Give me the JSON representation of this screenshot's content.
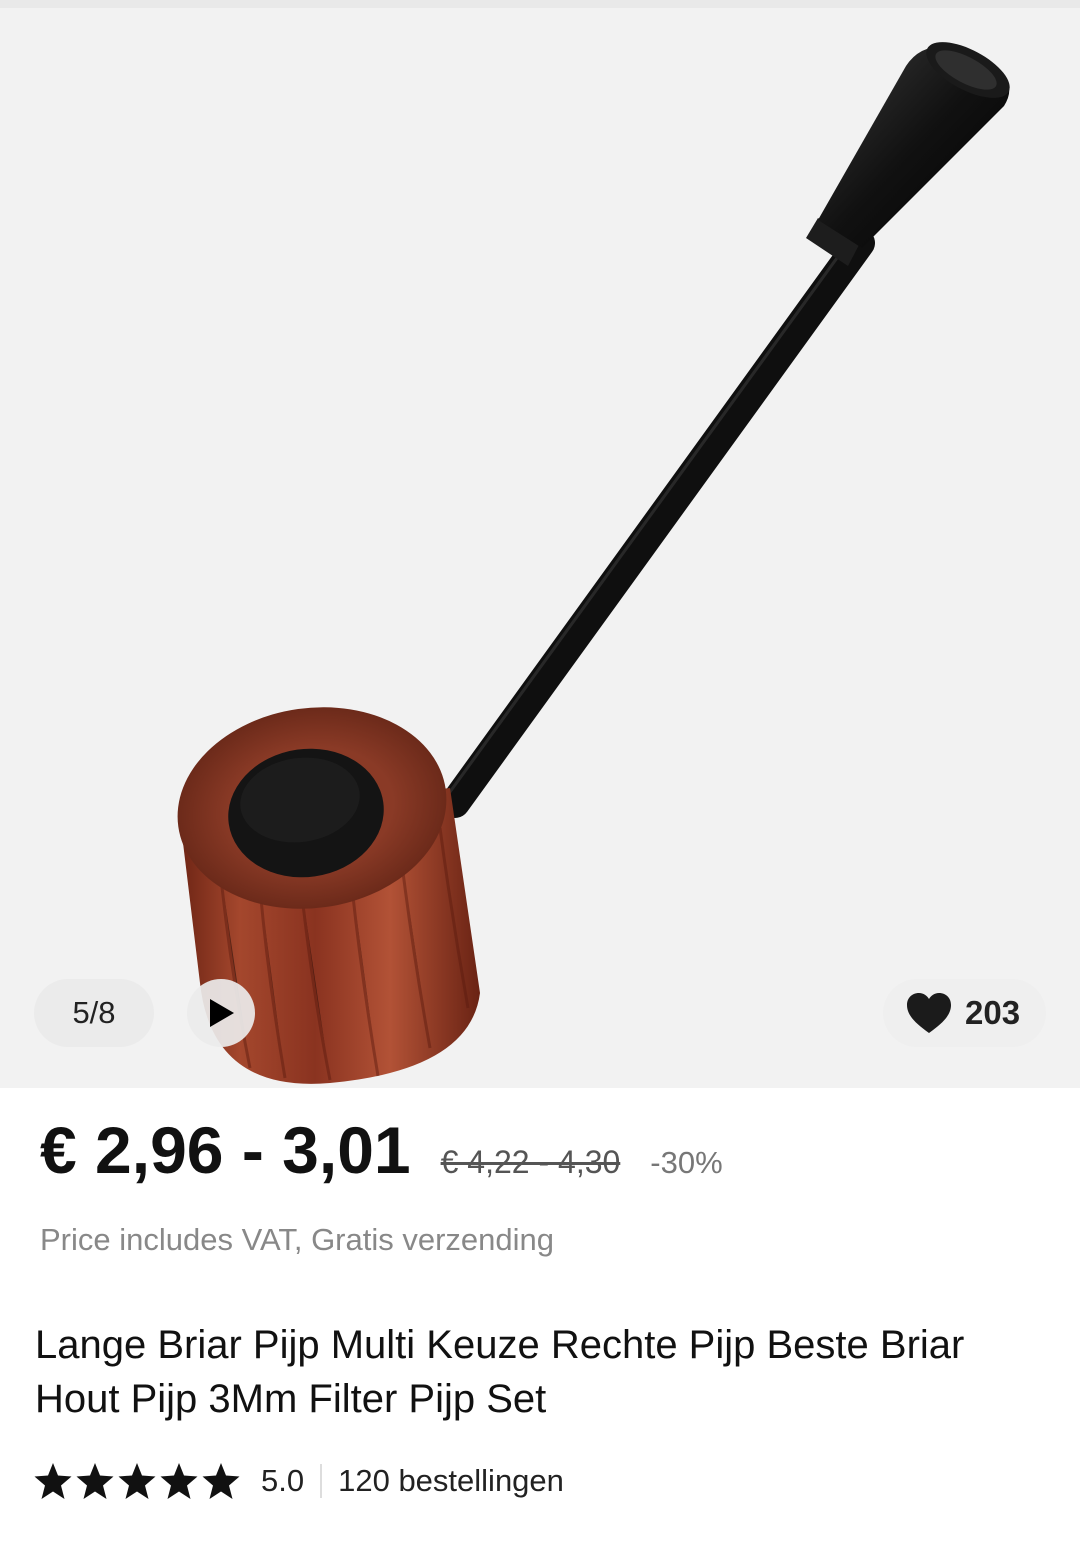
{
  "gallery": {
    "counter": "5/8",
    "wishlist_count": "203",
    "image_alt": "Briar pipe product photo"
  },
  "price": {
    "current": "€ 2,96 - 3,01",
    "original": "€ 4,22 - 4,30",
    "discount": "-30%"
  },
  "vat_note": "Price includes VAT, Gratis verzending",
  "product_title": "Lange Briar Pijp Multi Keuze Rechte Pijp Beste Briar Hout Pijp 3Mm Filter Pijp Set",
  "rating": {
    "value": "5.0",
    "stars": 5,
    "orders": "120 bestellingen"
  },
  "colors": {
    "gallery_bg": "#f2f2f2",
    "wood": "#8e3a25",
    "stem": "#141414"
  },
  "icons": [
    "play-icon",
    "heart-icon",
    "star-icon"
  ]
}
